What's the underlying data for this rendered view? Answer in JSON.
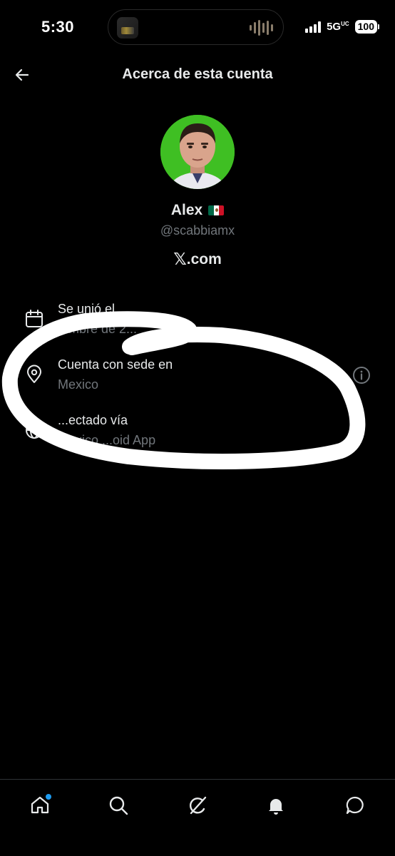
{
  "status_bar": {
    "time": "5:30",
    "network": "5G",
    "network_suffix": "UC",
    "battery": "100"
  },
  "header": {
    "title": "Acerca de esta cuenta",
    "back_icon": "arrow-left-icon"
  },
  "profile": {
    "name": "Alex",
    "flag": "mexico-flag",
    "handle": "@scabbiamx",
    "site_logo": "𝕏",
    "site_suffix": ".com"
  },
  "info": [
    {
      "icon": "calendar-icon",
      "title": "Se unió el",
      "value": "...mbre de 2..."
    },
    {
      "icon": "location-pin-icon",
      "title": "Cuenta con sede en",
      "value": "Mexico",
      "more_icon": "info-icon"
    },
    {
      "icon": "globe-icon",
      "title": "...ectado vía",
      "value": "Mexico ...oid App"
    }
  ],
  "bottom_nav": [
    {
      "icon": "home-icon",
      "notification": true
    },
    {
      "icon": "search-icon"
    },
    {
      "icon": "grok-icon"
    },
    {
      "icon": "bell-icon"
    },
    {
      "icon": "messages-icon"
    }
  ],
  "colors": {
    "background": "#000000",
    "text_primary": "#e7e9ea",
    "text_secondary": "#71767b",
    "accent": "#1d9bf0",
    "annotation": "#ffffff"
  }
}
